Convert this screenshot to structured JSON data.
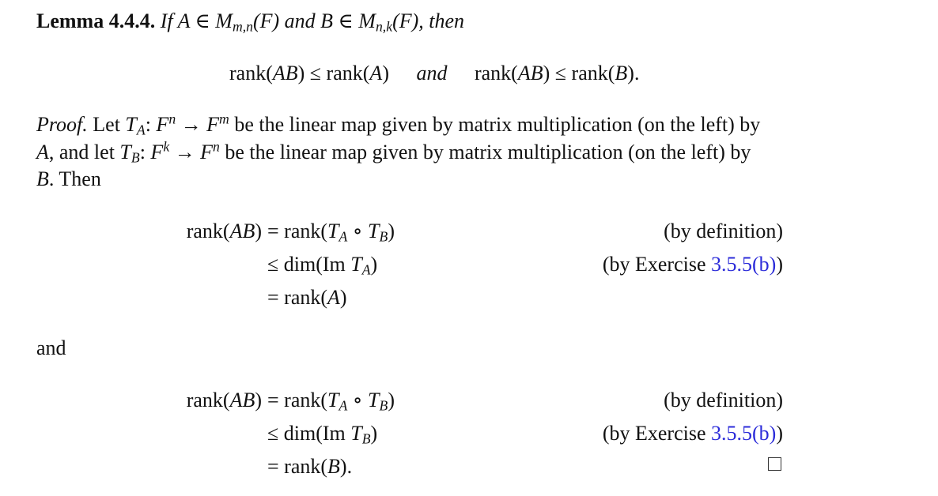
{
  "lemma": {
    "label": "Lemma 4.4.4.",
    "statement_parts": [
      "If",
      "A",
      "∈",
      "M",
      "m,n",
      "(F)",
      "and",
      "B",
      "∈",
      "M",
      "n,k",
      "(F), then"
    ],
    "display": {
      "left": "rank(AB) ≤ rank(A)",
      "connector": "and",
      "right": "rank(AB) ≤ rank(B)."
    }
  },
  "proof": {
    "label": "Proof.",
    "line1_text": "be the linear map given by matrix multiplication (on the left) by",
    "line2_text": "be the linear map given by matrix multiplication (on the left) by",
    "line3_text": "Then",
    "first_chain": {
      "rows": [
        {
          "lhs": "rank(AB)",
          "rel": "=",
          "rhs": "rank(T_A ∘ T_B)",
          "justification": "(by definition)"
        },
        {
          "lhs": "",
          "rel": "≤",
          "rhs": "dim(Im T_A)",
          "justification_prefix": "(by Exercise ",
          "link": "3.5.5(b)",
          "justification_suffix": ")"
        },
        {
          "lhs": "",
          "rel": "=",
          "rhs": "rank(A)"
        }
      ]
    },
    "between_word": "and",
    "second_chain": {
      "rows": [
        {
          "lhs": "rank(AB)",
          "rel": "=",
          "rhs": "rank(T_A ∘ T_B)",
          "justification": "(by definition)"
        },
        {
          "lhs": "",
          "rel": "≤",
          "rhs": "dim(Im T_B)",
          "justification_prefix": "(by Exercise ",
          "link": "3.5.5(b)",
          "justification_suffix": ")"
        },
        {
          "lhs": "",
          "rel": "=",
          "rhs": "rank(B)."
        }
      ]
    },
    "qed_symbol": "□"
  },
  "colors": {
    "text": "#111111",
    "link": "#2b2bd9"
  }
}
